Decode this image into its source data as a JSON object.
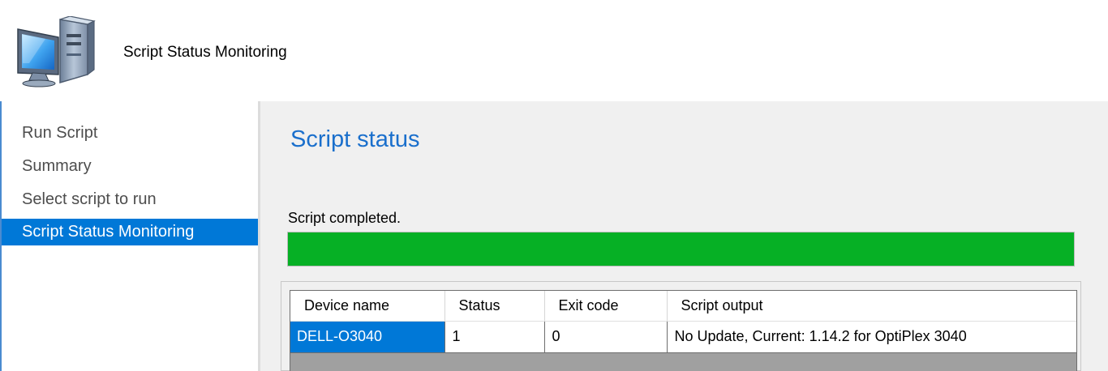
{
  "header": {
    "title": "Script Status Monitoring",
    "icon": "computer-icon"
  },
  "sidebar": {
    "items": [
      {
        "label": "Run Script",
        "selected": false
      },
      {
        "label": "Summary",
        "selected": false
      },
      {
        "label": "Select script to run",
        "selected": false
      },
      {
        "label": "Script Status Monitoring",
        "selected": true
      }
    ]
  },
  "main": {
    "section_title": "Script status",
    "status_text": "Script completed.",
    "progress_percent": 100,
    "progress_color": "#06b025",
    "table": {
      "columns": [
        "Device name",
        "Status",
        "Exit code",
        "Script output"
      ],
      "rows": [
        [
          "DELL-O3040",
          "1",
          "0",
          "No Update, Current: 1.14.2 for OptiPlex 3040"
        ]
      ]
    }
  },
  "colors": {
    "accent": "#0078d7",
    "section_title": "#1a6fcc",
    "progress": "#06b025"
  }
}
